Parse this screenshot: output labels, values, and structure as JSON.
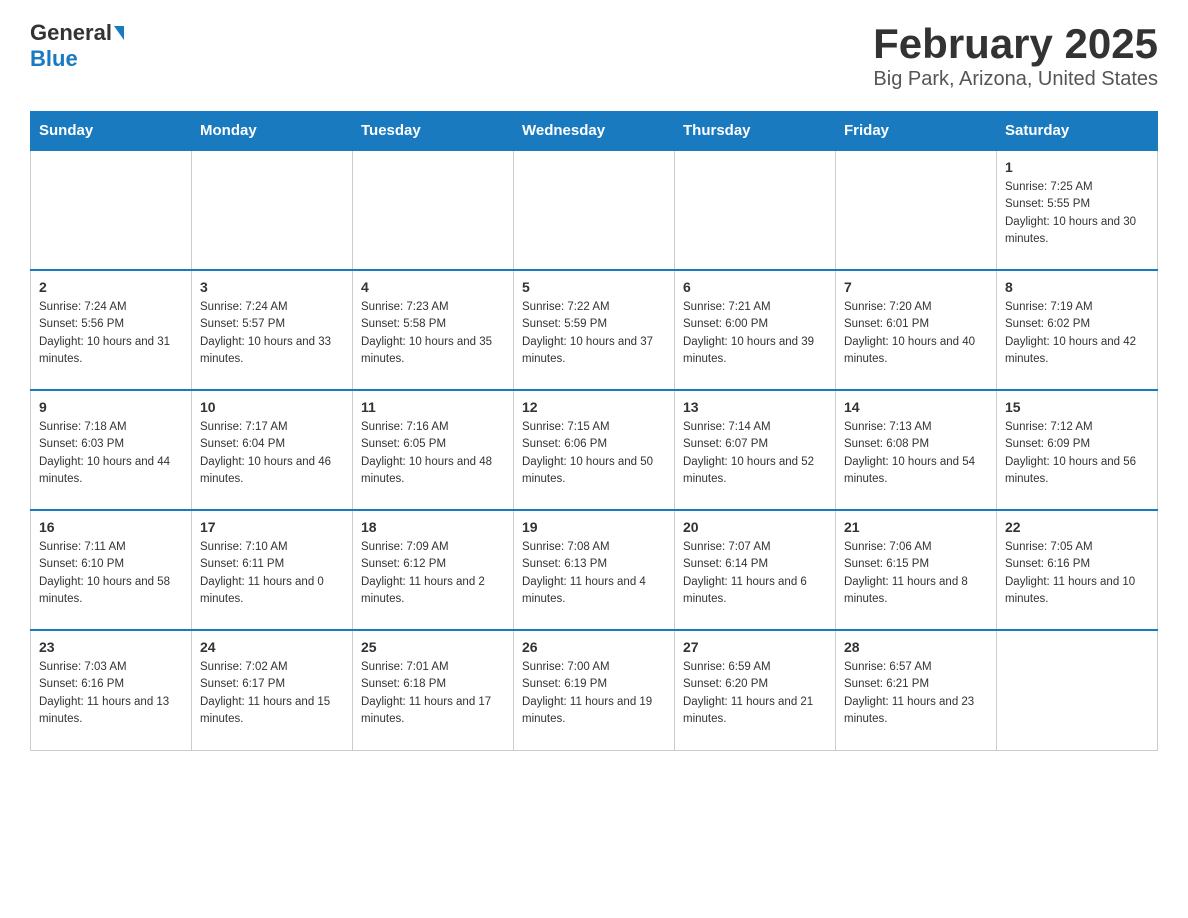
{
  "header": {
    "logo_general": "General",
    "logo_blue": "Blue",
    "title": "February 2025",
    "subtitle": "Big Park, Arizona, United States"
  },
  "days_of_week": [
    "Sunday",
    "Monday",
    "Tuesday",
    "Wednesday",
    "Thursday",
    "Friday",
    "Saturday"
  ],
  "weeks": [
    {
      "days": [
        {
          "number": "",
          "sunrise": "",
          "sunset": "",
          "daylight": ""
        },
        {
          "number": "",
          "sunrise": "",
          "sunset": "",
          "daylight": ""
        },
        {
          "number": "",
          "sunrise": "",
          "sunset": "",
          "daylight": ""
        },
        {
          "number": "",
          "sunrise": "",
          "sunset": "",
          "daylight": ""
        },
        {
          "number": "",
          "sunrise": "",
          "sunset": "",
          "daylight": ""
        },
        {
          "number": "",
          "sunrise": "",
          "sunset": "",
          "daylight": ""
        },
        {
          "number": "1",
          "sunrise": "Sunrise: 7:25 AM",
          "sunset": "Sunset: 5:55 PM",
          "daylight": "Daylight: 10 hours and 30 minutes."
        }
      ]
    },
    {
      "days": [
        {
          "number": "2",
          "sunrise": "Sunrise: 7:24 AM",
          "sunset": "Sunset: 5:56 PM",
          "daylight": "Daylight: 10 hours and 31 minutes."
        },
        {
          "number": "3",
          "sunrise": "Sunrise: 7:24 AM",
          "sunset": "Sunset: 5:57 PM",
          "daylight": "Daylight: 10 hours and 33 minutes."
        },
        {
          "number": "4",
          "sunrise": "Sunrise: 7:23 AM",
          "sunset": "Sunset: 5:58 PM",
          "daylight": "Daylight: 10 hours and 35 minutes."
        },
        {
          "number": "5",
          "sunrise": "Sunrise: 7:22 AM",
          "sunset": "Sunset: 5:59 PM",
          "daylight": "Daylight: 10 hours and 37 minutes."
        },
        {
          "number": "6",
          "sunrise": "Sunrise: 7:21 AM",
          "sunset": "Sunset: 6:00 PM",
          "daylight": "Daylight: 10 hours and 39 minutes."
        },
        {
          "number": "7",
          "sunrise": "Sunrise: 7:20 AM",
          "sunset": "Sunset: 6:01 PM",
          "daylight": "Daylight: 10 hours and 40 minutes."
        },
        {
          "number": "8",
          "sunrise": "Sunrise: 7:19 AM",
          "sunset": "Sunset: 6:02 PM",
          "daylight": "Daylight: 10 hours and 42 minutes."
        }
      ]
    },
    {
      "days": [
        {
          "number": "9",
          "sunrise": "Sunrise: 7:18 AM",
          "sunset": "Sunset: 6:03 PM",
          "daylight": "Daylight: 10 hours and 44 minutes."
        },
        {
          "number": "10",
          "sunrise": "Sunrise: 7:17 AM",
          "sunset": "Sunset: 6:04 PM",
          "daylight": "Daylight: 10 hours and 46 minutes."
        },
        {
          "number": "11",
          "sunrise": "Sunrise: 7:16 AM",
          "sunset": "Sunset: 6:05 PM",
          "daylight": "Daylight: 10 hours and 48 minutes."
        },
        {
          "number": "12",
          "sunrise": "Sunrise: 7:15 AM",
          "sunset": "Sunset: 6:06 PM",
          "daylight": "Daylight: 10 hours and 50 minutes."
        },
        {
          "number": "13",
          "sunrise": "Sunrise: 7:14 AM",
          "sunset": "Sunset: 6:07 PM",
          "daylight": "Daylight: 10 hours and 52 minutes."
        },
        {
          "number": "14",
          "sunrise": "Sunrise: 7:13 AM",
          "sunset": "Sunset: 6:08 PM",
          "daylight": "Daylight: 10 hours and 54 minutes."
        },
        {
          "number": "15",
          "sunrise": "Sunrise: 7:12 AM",
          "sunset": "Sunset: 6:09 PM",
          "daylight": "Daylight: 10 hours and 56 minutes."
        }
      ]
    },
    {
      "days": [
        {
          "number": "16",
          "sunrise": "Sunrise: 7:11 AM",
          "sunset": "Sunset: 6:10 PM",
          "daylight": "Daylight: 10 hours and 58 minutes."
        },
        {
          "number": "17",
          "sunrise": "Sunrise: 7:10 AM",
          "sunset": "Sunset: 6:11 PM",
          "daylight": "Daylight: 11 hours and 0 minutes."
        },
        {
          "number": "18",
          "sunrise": "Sunrise: 7:09 AM",
          "sunset": "Sunset: 6:12 PM",
          "daylight": "Daylight: 11 hours and 2 minutes."
        },
        {
          "number": "19",
          "sunrise": "Sunrise: 7:08 AM",
          "sunset": "Sunset: 6:13 PM",
          "daylight": "Daylight: 11 hours and 4 minutes."
        },
        {
          "number": "20",
          "sunrise": "Sunrise: 7:07 AM",
          "sunset": "Sunset: 6:14 PM",
          "daylight": "Daylight: 11 hours and 6 minutes."
        },
        {
          "number": "21",
          "sunrise": "Sunrise: 7:06 AM",
          "sunset": "Sunset: 6:15 PM",
          "daylight": "Daylight: 11 hours and 8 minutes."
        },
        {
          "number": "22",
          "sunrise": "Sunrise: 7:05 AM",
          "sunset": "Sunset: 6:16 PM",
          "daylight": "Daylight: 11 hours and 10 minutes."
        }
      ]
    },
    {
      "days": [
        {
          "number": "23",
          "sunrise": "Sunrise: 7:03 AM",
          "sunset": "Sunset: 6:16 PM",
          "daylight": "Daylight: 11 hours and 13 minutes."
        },
        {
          "number": "24",
          "sunrise": "Sunrise: 7:02 AM",
          "sunset": "Sunset: 6:17 PM",
          "daylight": "Daylight: 11 hours and 15 minutes."
        },
        {
          "number": "25",
          "sunrise": "Sunrise: 7:01 AM",
          "sunset": "Sunset: 6:18 PM",
          "daylight": "Daylight: 11 hours and 17 minutes."
        },
        {
          "number": "26",
          "sunrise": "Sunrise: 7:00 AM",
          "sunset": "Sunset: 6:19 PM",
          "daylight": "Daylight: 11 hours and 19 minutes."
        },
        {
          "number": "27",
          "sunrise": "Sunrise: 6:59 AM",
          "sunset": "Sunset: 6:20 PM",
          "daylight": "Daylight: 11 hours and 21 minutes."
        },
        {
          "number": "28",
          "sunrise": "Sunrise: 6:57 AM",
          "sunset": "Sunset: 6:21 PM",
          "daylight": "Daylight: 11 hours and 23 minutes."
        },
        {
          "number": "",
          "sunrise": "",
          "sunset": "",
          "daylight": ""
        }
      ]
    }
  ]
}
